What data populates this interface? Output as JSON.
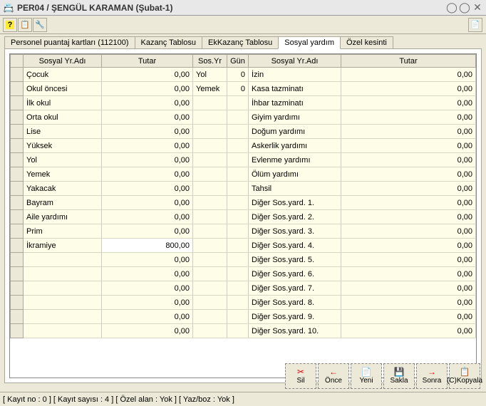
{
  "window": {
    "title": "PER04 / ŞENGÜL KARAMAN (Şubat-1)"
  },
  "tabs": [
    {
      "label": "Personel puantaj kartları (112100)"
    },
    {
      "label": "Kazanç Tablosu"
    },
    {
      "label": "EkKazanç Tablosu"
    },
    {
      "label": "Sosyal yardım"
    },
    {
      "label": "Özel kesinti"
    }
  ],
  "grid": {
    "headers": {
      "rowhdr": "",
      "name1": "Sosyal Yr.Adı",
      "tutar1": "Tutar",
      "sosyr": "Sos.Yr",
      "gun": "Gün",
      "name2": "Sosyal Yr.Adı",
      "tutar2": "Tutar"
    },
    "rows": [
      {
        "n1": "Çocuk",
        "t1": "0,00",
        "sy": "Yol",
        "g": "0",
        "n2": "İzin",
        "t2": "0,00"
      },
      {
        "n1": "Okul öncesi",
        "t1": "0,00",
        "sy": "Yemek",
        "g": "0",
        "n2": "Kasa tazminatı",
        "t2": "0,00"
      },
      {
        "n1": "İlk okul",
        "t1": "0,00",
        "sy": "",
        "g": "",
        "n2": "İhbar tazminatı",
        "t2": "0,00"
      },
      {
        "n1": "Orta okul",
        "t1": "0,00",
        "sy": "",
        "g": "",
        "n2": "Giyim yardımı",
        "t2": "0,00"
      },
      {
        "n1": "Lise",
        "t1": "0,00",
        "sy": "",
        "g": "",
        "n2": "Doğum yardımı",
        "t2": "0,00"
      },
      {
        "n1": "Yüksek",
        "t1": "0,00",
        "sy": "",
        "g": "",
        "n2": "Askerlik yardımı",
        "t2": "0,00"
      },
      {
        "n1": "Yol",
        "t1": "0,00",
        "sy": "",
        "g": "",
        "n2": "Evlenme yardımı",
        "t2": "0,00"
      },
      {
        "n1": "Yemek",
        "t1": "0,00",
        "sy": "",
        "g": "",
        "n2": "Ölüm yardımı",
        "t2": "0,00"
      },
      {
        "n1": "Yakacak",
        "t1": "0,00",
        "sy": "",
        "g": "",
        "n2": "Tahsil",
        "t2": "0,00"
      },
      {
        "n1": "Bayram",
        "t1": "0,00",
        "sy": "",
        "g": "",
        "n2": "Diğer Sos.yard. 1.",
        "t2": "0,00"
      },
      {
        "n1": "Aile yardımı",
        "t1": "0,00",
        "sy": "",
        "g": "",
        "n2": "Diğer Sos.yard. 2.",
        "t2": "0,00"
      },
      {
        "n1": "Prim",
        "t1": "0,00",
        "sy": "",
        "g": "",
        "n2": "Diğer Sos.yard. 3.",
        "t2": "0,00"
      },
      {
        "n1": "İkramiye",
        "t1": "800,00",
        "sy": "",
        "g": "",
        "n2": "Diğer Sos.yard. 4.",
        "t2": "0,00",
        "edit": true
      },
      {
        "n1": "",
        "t1": "0,00",
        "sy": "",
        "g": "",
        "n2": "Diğer Sos.yard. 5.",
        "t2": "0,00"
      },
      {
        "n1": "",
        "t1": "0,00",
        "sy": "",
        "g": "",
        "n2": "Diğer Sos.yard. 6.",
        "t2": "0,00"
      },
      {
        "n1": "",
        "t1": "0,00",
        "sy": "",
        "g": "",
        "n2": "Diğer Sos.yard. 7.",
        "t2": "0,00"
      },
      {
        "n1": "",
        "t1": "0,00",
        "sy": "",
        "g": "",
        "n2": "Diğer Sos.yard. 8.",
        "t2": "0,00"
      },
      {
        "n1": "",
        "t1": "0,00",
        "sy": "",
        "g": "",
        "n2": "Diğer Sos.yard. 9.",
        "t2": "0,00"
      },
      {
        "n1": "",
        "t1": "0,00",
        "sy": "",
        "g": "",
        "n2": "Diğer Sos.yard. 10.",
        "t2": "0,00"
      }
    ]
  },
  "commands": {
    "sil": {
      "label": "Sil"
    },
    "once": {
      "label": "Önce"
    },
    "yeni": {
      "label": "Yeni"
    },
    "sakla": {
      "label": "Sakla"
    },
    "sonra": {
      "label": "Sonra"
    },
    "kopya": {
      "label": "(C)Kopyala"
    }
  },
  "statusbar": {
    "text": "[ Kayıt no : 0 ] [ Kayıt sayısı : 4 ] [ Özel alan : Yok ] [ Yaz/boz : Yok ]"
  }
}
